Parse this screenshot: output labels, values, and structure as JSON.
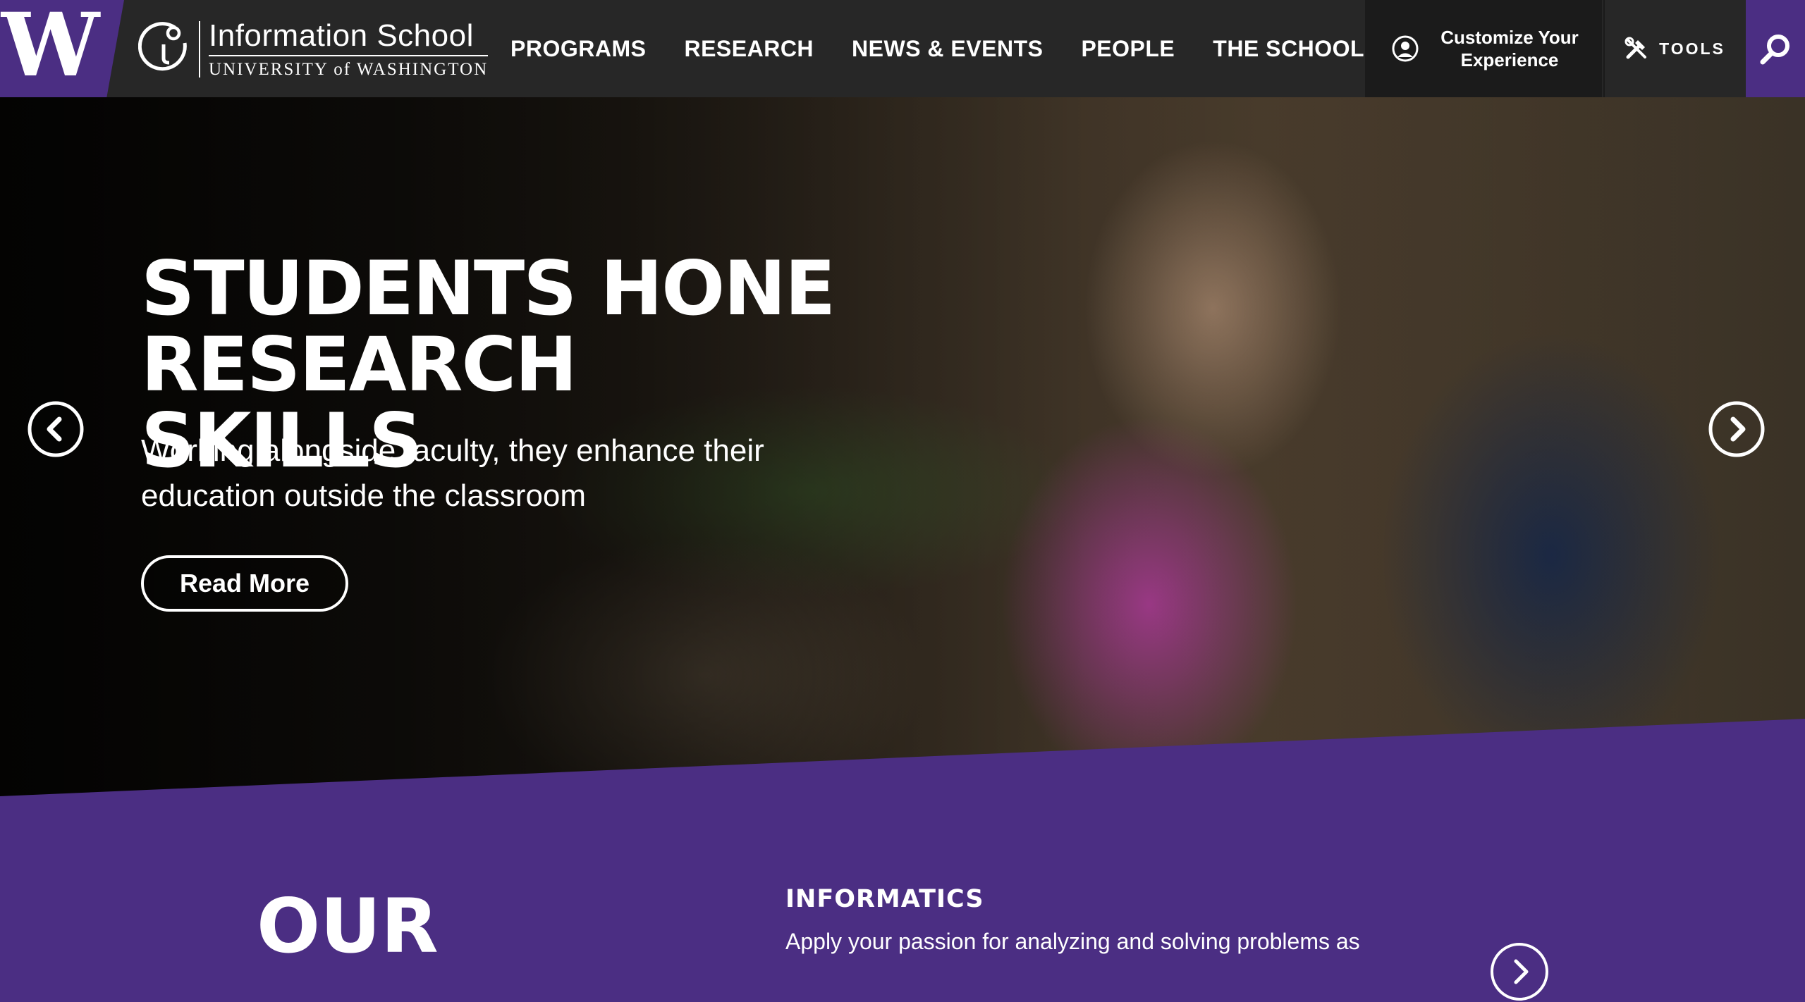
{
  "header": {
    "uw_mark": "W",
    "logo_line1": "Information School",
    "logo_line2": "UNIVERSITY of WASHINGTON",
    "nav": [
      {
        "label": "PROGRAMS"
      },
      {
        "label": "RESEARCH"
      },
      {
        "label": "NEWS & EVENTS"
      },
      {
        "label": "PEOPLE"
      },
      {
        "label": "THE SCHOOL"
      }
    ],
    "customize_label": "Customize Your Experience",
    "tools_label": "TOOLS"
  },
  "hero": {
    "title": "STUDENTS HONE RESEARCH SKILLS",
    "subtitle": "Working alongside faculty, they enhance their education outside the classroom",
    "cta_label": "Read More"
  },
  "programs": {
    "section_label": "OUR",
    "current_title": "INFORMATICS",
    "current_description": "Apply your passion for analyzing and solving problems as"
  },
  "icons": {
    "prev": "chevron-left-icon",
    "next": "chevron-right-icon",
    "account": "user-circle-icon",
    "tools": "tools-icon",
    "search": "search-icon"
  },
  "colors": {
    "brand_purple": "#4b2e83",
    "header_bg": "#272727",
    "customize_bg": "#1b1b1b"
  }
}
